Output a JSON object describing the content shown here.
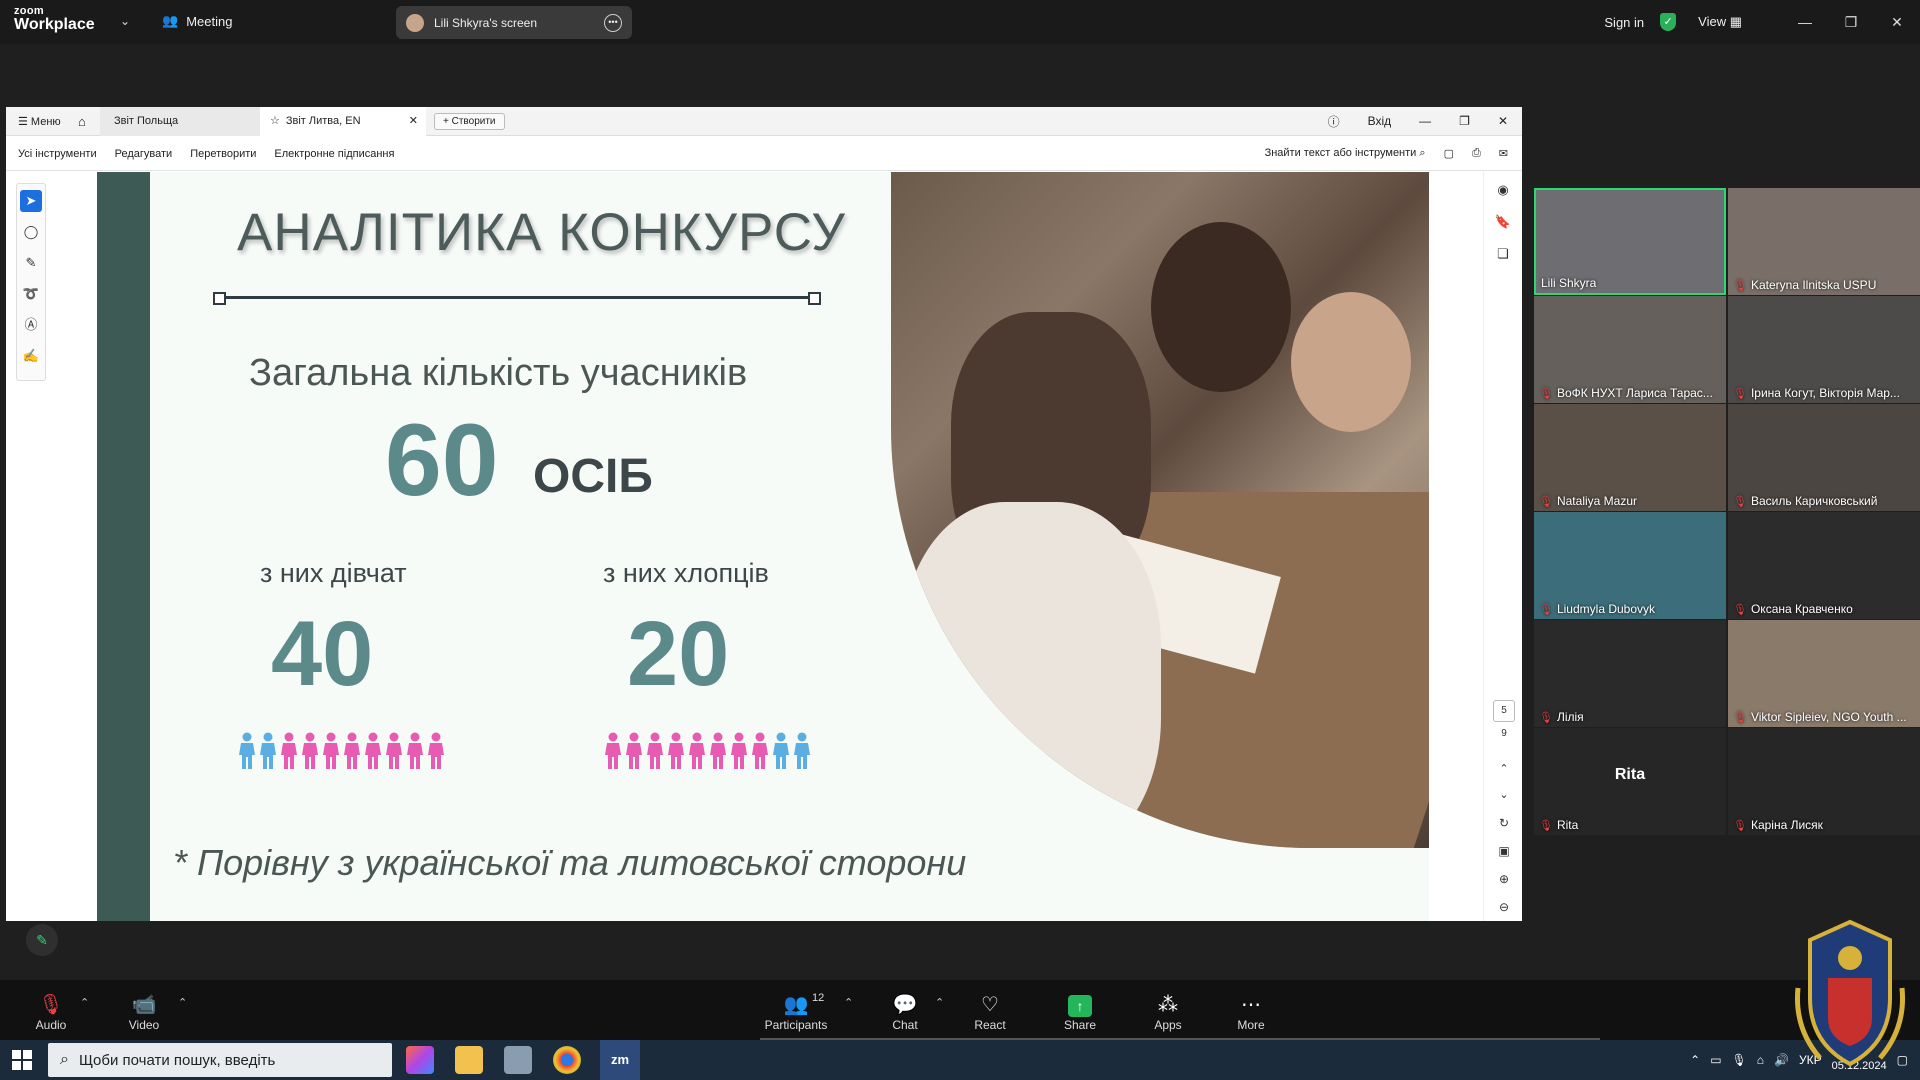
{
  "topbar": {
    "logo_line1": "zoom",
    "logo_line2": "Workplace",
    "meeting_label": "Meeting",
    "share_label": "Lili  Shkyra's screen",
    "sign_in": "Sign in",
    "view": "View"
  },
  "pdf": {
    "menu": "Меню",
    "tab1": "Звіт Польща",
    "tab2": "Звіт Литва, EN",
    "new_tab": "Створити",
    "login": "Вхід",
    "tools": [
      "Усі інструменти",
      "Редагувати",
      "Перетворити",
      "Електронне підписання"
    ],
    "find": "Знайти текст або інструменти",
    "page_current": "5",
    "page_total": "9"
  },
  "slide": {
    "title": "АНАЛІТИКА КОНКУРСУ",
    "total_label": "Загальна кількість учасників",
    "total_value": "60",
    "total_unit": "ОСІБ",
    "girls_label": "з них дівчат",
    "girls_value": "40",
    "boys_label": "з них хлопців",
    "boys_value": "20",
    "footnote": "* Порівну з української та литовської сторони",
    "colors": {
      "blue": "#5aaee2",
      "pink": "#e85bb2",
      "teal": "#5c8a8b",
      "strip": "#3e5a55"
    },
    "girls_icons": [
      "blue",
      "blue",
      "pink",
      "pink",
      "pink",
      "pink",
      "pink",
      "pink",
      "pink",
      "pink"
    ],
    "boys_icons": [
      "pink",
      "pink",
      "pink",
      "pink",
      "pink",
      "pink",
      "pink",
      "pink",
      "blue",
      "blue"
    ]
  },
  "gallery": [
    {
      "name": "Lili  Shkyra",
      "muted": false,
      "active": true,
      "bg": "#6e6e72"
    },
    {
      "name": "Kateryna Ilnitska USPU",
      "muted": true,
      "active": false,
      "bg": "#7a6f68"
    },
    {
      "name": "ВоФК НУХТ Лариса Тарас...",
      "muted": true,
      "active": false,
      "bg": "#65605c"
    },
    {
      "name": "Ірина Когут, Вікторія Мар...",
      "muted": true,
      "active": false,
      "bg": "#4d4b4a"
    },
    {
      "name": "Nataliya Mazur",
      "muted": true,
      "active": false,
      "bg": "#5a5048"
    },
    {
      "name": "Василь Каричковський",
      "muted": true,
      "active": false,
      "bg": "#4c4642"
    },
    {
      "name": "Liudmyla Dubovyk",
      "muted": true,
      "active": false,
      "bg": "#3b6e7a"
    },
    {
      "name": "Оксана Кравченко",
      "muted": true,
      "active": false,
      "bg": "#2c2c2c"
    },
    {
      "name": "Лілія",
      "muted": true,
      "active": false,
      "bg": "#2a2a2a"
    },
    {
      "name": "Viktor Sipleiev, NGO Youth ...",
      "muted": true,
      "active": false,
      "bg": "#8a7a6a"
    },
    {
      "name": "Rita",
      "muted": true,
      "active": false,
      "bg": "#262626",
      "center": "Rita"
    },
    {
      "name": "Каріна Лисяк",
      "muted": true,
      "active": false,
      "bg": "#262626"
    }
  ],
  "toolbar": {
    "audio": "Audio",
    "video": "Video",
    "participants": "Participants",
    "participants_count": "12",
    "chat": "Chat",
    "react": "React",
    "share": "Share",
    "apps": "Apps",
    "more": "More"
  },
  "taskbar": {
    "search_placeholder": "Щоби почати пошук, введіть",
    "lang": "УКР",
    "date": "05.12.2024"
  }
}
